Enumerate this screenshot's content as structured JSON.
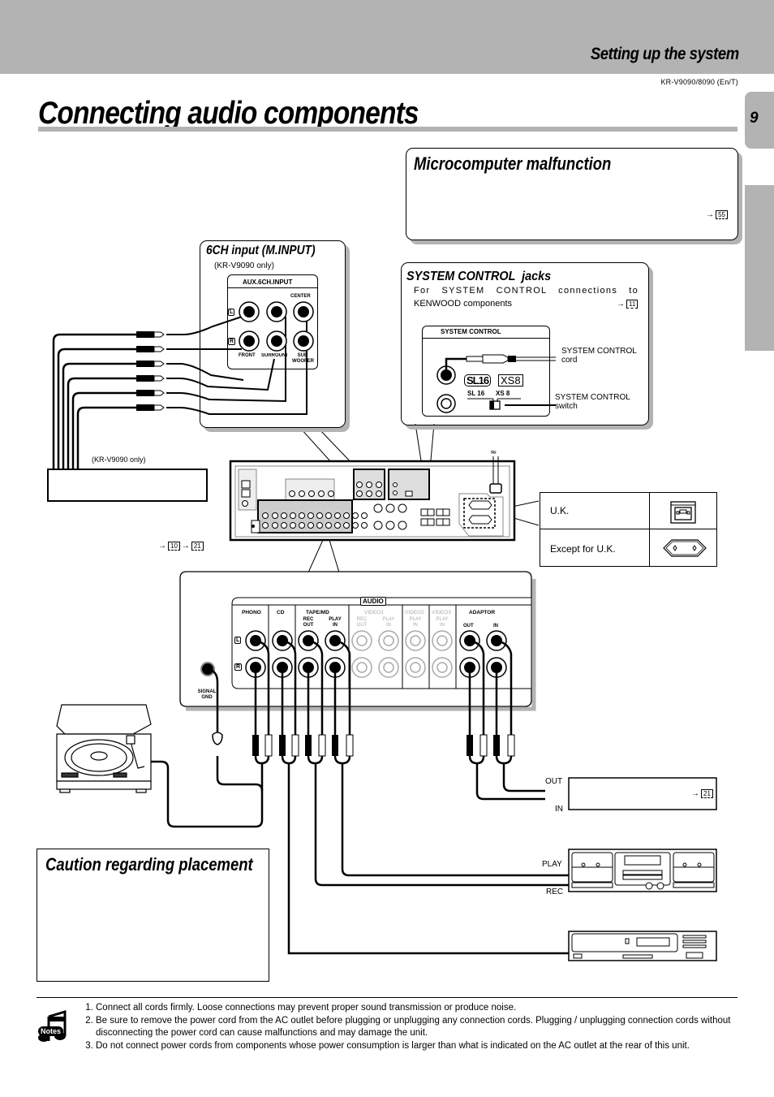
{
  "header": {
    "section_title": "Setting up the system",
    "model": "KR-V9090/8090 (En/T)",
    "page_title": "Connecting audio components",
    "page_number": "9"
  },
  "microcomputer_box": {
    "title": "Microcomputer malfunction",
    "ref_page": "55"
  },
  "six_ch_box": {
    "title": "6CH input (M.INPUT)",
    "subtitle": "(KR-V9090 only)",
    "panel_label": "AUX.6CH.INPUT",
    "center_label": "CENTER",
    "front_label": "FRONT",
    "surround_label": "SURROUND",
    "subwoofer_label": "SUB WOOFER",
    "left_badge": "L",
    "right_badge": "R"
  },
  "system_control_box": {
    "title": "SYSTEM CONTROL  jacks",
    "description_line1": "For SYSTEM CONTROL connections to",
    "description_line2": "KENWOOD components",
    "ref_page": "11",
    "panel_label": "SYSTEM CONTROL",
    "cord_label_line1": "SYSTEM CONTROL",
    "cord_label_line2": "cord",
    "switch_label_line1": "SYSTEM CONTROL",
    "switch_label_line2": "switch",
    "logo_sl16": "SL16",
    "logo_xs8": "XS8",
    "switch_sl16": "SL 16",
    "switch_xs8": "XS 8"
  },
  "left_device": {
    "note": "(KR-V9090 only)",
    "refs": [
      "10",
      "21"
    ]
  },
  "power_table": {
    "rows": [
      {
        "label": "U.K.",
        "icon": "uk-outlet-icon"
      },
      {
        "label": "Except for U.K.",
        "icon": "euro-outlet-icon"
      }
    ]
  },
  "audio_panel": {
    "group_label": "AUDIO",
    "columns": [
      {
        "name": "PHONO",
        "sub": [
          "",
          ""
        ],
        "active": true
      },
      {
        "name": "CD",
        "sub": [
          "",
          ""
        ],
        "active": true
      },
      {
        "name": "TAPE/MD",
        "sub": [
          "REC OUT",
          "PLAY IN"
        ],
        "active": true
      },
      {
        "name": "VIDEO1",
        "sub": [
          "REC OUT",
          "PLAY IN"
        ],
        "active": false
      },
      {
        "name": "VIDEO2",
        "sub": [
          "PLAY IN"
        ],
        "active": false
      },
      {
        "name": "VIDEO3",
        "sub": [
          "PLAY IN"
        ],
        "active": false
      },
      {
        "name": "ADAPTOR",
        "sub": [
          "OUT",
          "IN"
        ],
        "active": true
      }
    ],
    "left_badge": "L",
    "right_badge": "R",
    "signal_gnd_line1": "SIGNAL",
    "signal_gnd_line2": "GND"
  },
  "adaptor_device": {
    "out_label": "OUT",
    "in_label": "IN",
    "ref_page": "21"
  },
  "tape_deck": {
    "play_label": "PLAY",
    "rec_label": "REC"
  },
  "caution_box": {
    "title": "Caution regarding placement"
  },
  "notes": {
    "icon_label": "Notes",
    "items": [
      "Connect all cords firmly. Loose connections may prevent proper sound transmission or produce noise.",
      "Be sure to remove the power cord from the AC outlet before plugging or unplugging any connection cords. Plugging / unplugging connection cords without disconnecting the power cord can cause malfunctions and may damage the unit.",
      "Do not connect power cords from components whose power consumption is larger than what is indicated on the AC outlet at the rear of this unit."
    ]
  }
}
